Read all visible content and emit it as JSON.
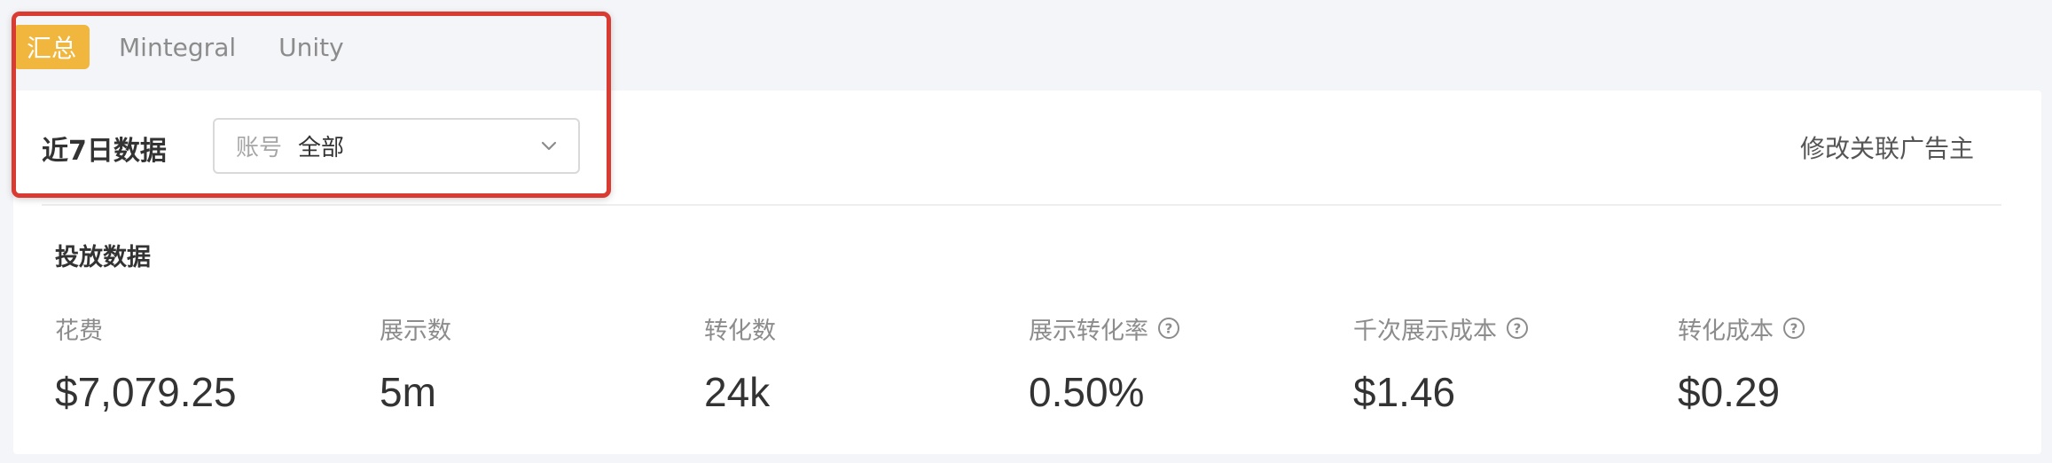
{
  "tabs": [
    {
      "label": "汇总",
      "active": true
    },
    {
      "label": "Mintegral",
      "active": false
    },
    {
      "label": "Unity",
      "active": false
    }
  ],
  "header": {
    "title": "近7日数据",
    "account_select": {
      "label": "账号",
      "value": "全部"
    },
    "modify_link": "修改关联广告主"
  },
  "section": {
    "title": "投放数据"
  },
  "metrics": [
    {
      "label": "花费",
      "value": "$7,079.25",
      "has_help": false
    },
    {
      "label": "展示数",
      "value": "5m",
      "has_help": false
    },
    {
      "label": "转化数",
      "value": "24k",
      "has_help": false
    },
    {
      "label": "展示转化率",
      "value": "0.50%",
      "has_help": true
    },
    {
      "label": "千次展示成本",
      "value": "$1.46",
      "has_help": true
    },
    {
      "label": "转化成本",
      "value": "$0.29",
      "has_help": true
    }
  ],
  "colors": {
    "accent": "#f0b63e",
    "highlight": "#d93a31",
    "background": "#f4f5f8"
  }
}
